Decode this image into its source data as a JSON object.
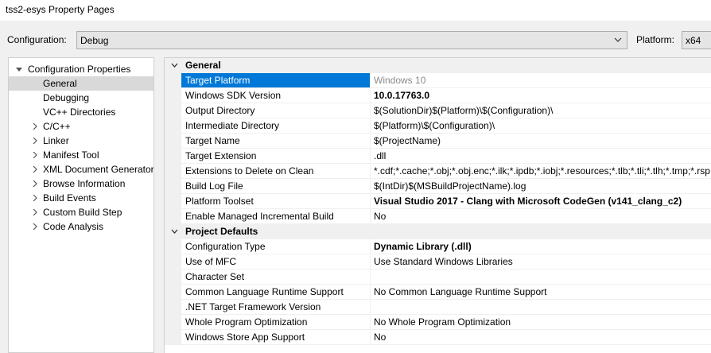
{
  "window": {
    "title": "tss2-esys Property Pages"
  },
  "config": {
    "configuration_label": "Configuration:",
    "configuration_value": "Debug",
    "platform_label": "Platform:",
    "platform_value": "x64"
  },
  "tree": {
    "root": "Configuration Properties",
    "items": [
      {
        "label": "General"
      },
      {
        "label": "Debugging"
      },
      {
        "label": "VC++ Directories"
      },
      {
        "label": "C/C++"
      },
      {
        "label": "Linker"
      },
      {
        "label": "Manifest Tool"
      },
      {
        "label": "XML Document Generator"
      },
      {
        "label": "Browse Information"
      },
      {
        "label": "Build Events"
      },
      {
        "label": "Custom Build Step"
      },
      {
        "label": "Code Analysis"
      }
    ]
  },
  "grid": {
    "general": {
      "title": "General",
      "rows": [
        {
          "name": "Target Platform",
          "value": "Windows 10"
        },
        {
          "name": "Windows SDK Version",
          "value": "10.0.17763.0"
        },
        {
          "name": "Output Directory",
          "value": "$(SolutionDir)$(Platform)\\$(Configuration)\\"
        },
        {
          "name": "Intermediate Directory",
          "value": "$(Platform)\\$(Configuration)\\"
        },
        {
          "name": "Target Name",
          "value": "$(ProjectName)"
        },
        {
          "name": "Target Extension",
          "value": ".dll"
        },
        {
          "name": "Extensions to Delete on Clean",
          "value": "*.cdf;*.cache;*.obj;*.obj.enc;*.ilk;*.ipdb;*.iobj;*.resources;*.tlb;*.tli;*.tlh;*.tmp;*.rsp"
        },
        {
          "name": "Build Log File",
          "value": "$(IntDir)$(MSBuildProjectName).log"
        },
        {
          "name": "Platform Toolset",
          "value": "Visual Studio 2017 - Clang with Microsoft CodeGen (v141_clang_c2)"
        },
        {
          "name": "Enable Managed Incremental Build",
          "value": "No"
        }
      ]
    },
    "project_defaults": {
      "title": "Project Defaults",
      "rows": [
        {
          "name": "Configuration Type",
          "value": "Dynamic Library (.dll)"
        },
        {
          "name": "Use of MFC",
          "value": "Use Standard Windows Libraries"
        },
        {
          "name": "Character Set",
          "value": ""
        },
        {
          "name": "Common Language Runtime Support",
          "value": "No Common Language Runtime Support"
        },
        {
          "name": ".NET Target Framework Version",
          "value": ""
        },
        {
          "name": "Whole Program Optimization",
          "value": "No Whole Program Optimization"
        },
        {
          "name": "Windows Store App Support",
          "value": "No"
        }
      ]
    }
  }
}
